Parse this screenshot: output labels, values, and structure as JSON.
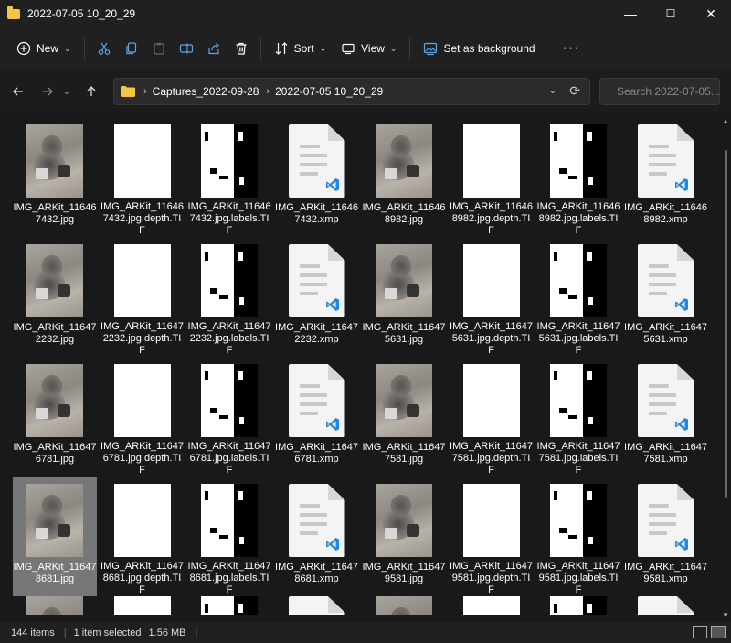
{
  "window": {
    "title": "2022-07-05 10_20_29",
    "minimize": "—",
    "maximize": "☐",
    "close": "✕"
  },
  "toolbar": {
    "new_label": "New",
    "sort_label": "Sort",
    "view_label": "View",
    "set_bg_label": "Set as background",
    "more": "···"
  },
  "address": {
    "crumbs": [
      "Captures_2022-09-28",
      "2022-07-05 10_20_29"
    ]
  },
  "search": {
    "placeholder": "Search 2022-07-05..."
  },
  "files": [
    {
      "name": "IMG_ARKit_116467432.jpg",
      "type": "photo"
    },
    {
      "name": "IMG_ARKit_116467432.jpg.depth.TIF",
      "type": "depth"
    },
    {
      "name": "IMG_ARKit_116467432.jpg.labels.TIF",
      "type": "labels"
    },
    {
      "name": "IMG_ARKit_116467432.xmp",
      "type": "xmp"
    },
    {
      "name": "IMG_ARKit_116468982.jpg",
      "type": "photo"
    },
    {
      "name": "IMG_ARKit_116468982.jpg.depth.TIF",
      "type": "depth"
    },
    {
      "name": "IMG_ARKit_116468982.jpg.labels.TIF",
      "type": "labels"
    },
    {
      "name": "IMG_ARKit_116468982.xmp",
      "type": "xmp"
    },
    {
      "name": "IMG_ARKit_116472232.jpg",
      "type": "photo"
    },
    {
      "name": "IMG_ARKit_116472232.jpg.depth.TIF",
      "type": "depth"
    },
    {
      "name": "IMG_ARKit_116472232.jpg.labels.TIF",
      "type": "labels"
    },
    {
      "name": "IMG_ARKit_116472232.xmp",
      "type": "xmp"
    },
    {
      "name": "IMG_ARKit_116475631.jpg",
      "type": "photo"
    },
    {
      "name": "IMG_ARKit_116475631.jpg.depth.TIF",
      "type": "depth"
    },
    {
      "name": "IMG_ARKit_116475631.jpg.labels.TIF",
      "type": "labels"
    },
    {
      "name": "IMG_ARKit_116475631.xmp",
      "type": "xmp"
    },
    {
      "name": "IMG_ARKit_116476781.jpg",
      "type": "photo"
    },
    {
      "name": "IMG_ARKit_116476781.jpg.depth.TIF",
      "type": "depth"
    },
    {
      "name": "IMG_ARKit_116476781.jpg.labels.TIF",
      "type": "labels"
    },
    {
      "name": "IMG_ARKit_116476781.xmp",
      "type": "xmp"
    },
    {
      "name": "IMG_ARKit_116477581.jpg",
      "type": "photo"
    },
    {
      "name": "IMG_ARKit_116477581.jpg.depth.TIF",
      "type": "depth"
    },
    {
      "name": "IMG_ARKit_116477581.jpg.labels.TIF",
      "type": "labels"
    },
    {
      "name": "IMG_ARKit_116477581.xmp",
      "type": "xmp"
    },
    {
      "name": "IMG_ARKit_116478681.jpg",
      "type": "photo",
      "selected": true
    },
    {
      "name": "IMG_ARKit_116478681.jpg.depth.TIF",
      "type": "depth"
    },
    {
      "name": "IMG_ARKit_116478681.jpg.labels.TIF",
      "type": "labels"
    },
    {
      "name": "IMG_ARKit_116478681.xmp",
      "type": "xmp"
    },
    {
      "name": "IMG_ARKit_116479581.jpg",
      "type": "photo"
    },
    {
      "name": "IMG_ARKit_116479581.jpg.depth.TIF",
      "type": "depth"
    },
    {
      "name": "IMG_ARKit_116479581.jpg.labels.TIF",
      "type": "labels"
    },
    {
      "name": "IMG_ARKit_116479581.xmp",
      "type": "xmp"
    }
  ],
  "partial_row": [
    "photo",
    "depth",
    "labels",
    "xmp",
    "photo",
    "depth",
    "labels",
    "xmp"
  ],
  "status": {
    "count": "144 items",
    "selected": "1 item selected",
    "size": "1.56 MB"
  },
  "colors": {
    "accent_folder": "#f4c542",
    "vscode_blue": "#1e88e5",
    "selection": "#777777"
  }
}
